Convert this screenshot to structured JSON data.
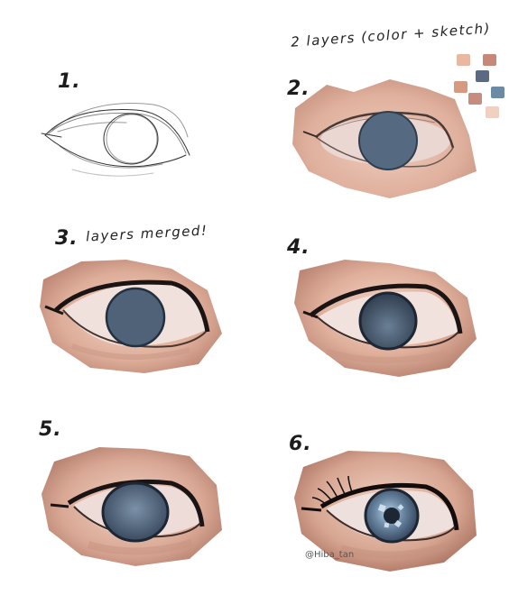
{
  "labels": {
    "step1": "1.",
    "step2": "2.",
    "step3": "3.",
    "step4": "4.",
    "step5": "5.",
    "step6": "6.",
    "note_step2": "2 layers (color + sketch)",
    "note_step3": "layers merged!",
    "watermark": "@Hiba_tan"
  },
  "palette": {
    "swatches": [
      "#e8b8a0",
      "#c88878",
      "#d79a80",
      "#5a6a82",
      "#c68c7e",
      "#e0a890",
      "#f0d0c0",
      "#6d8aa4"
    ]
  },
  "colors": {
    "skin_light": "#f1d3c4",
    "skin_mid": "#dcae9a",
    "skin_dark": "#b98270",
    "iris": "#4f6277",
    "iris_dark": "#2e3b4b",
    "sclera": "#f3e7e4",
    "line": "#1b1414"
  }
}
